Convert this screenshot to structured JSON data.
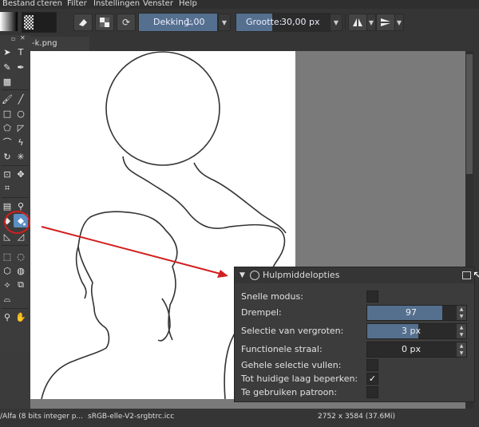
{
  "menubar": {
    "items": [
      "Bestand",
      "cteren",
      "Filter",
      "Instellingen",
      "Venster",
      "Help"
    ]
  },
  "toolbar": {
    "opacity_label": "Dekking:",
    "opacity_value": "1,00",
    "size_label": "Grootte:",
    "size_value": "30,00 px"
  },
  "document": {
    "tab_label": "-k.png"
  },
  "panel": {
    "title": "Hulpmiddelopties",
    "fast_mode_label": "Snelle modus:",
    "threshold_label": "Drempel:",
    "threshold_value": "97",
    "grow_selection_label": "Selectie van vergroten:",
    "grow_selection_value": "3 px",
    "feather_label": "Functionele straal:",
    "feather_value": "0 px",
    "fill_selection_label": "Gehele selectie vullen:",
    "limit_layer_label": "Tot huidige laag beperken:",
    "limit_layer_checked": "✓",
    "use_pattern_label": "Te gebruiken patroon:"
  },
  "status": {
    "colorspace": "/Alfa (8 bits integer p...",
    "profile": "sRGB-elle-V2-srgbtrc.icc",
    "dimensions": "2752 x 3584 (37.6Mi)"
  },
  "colors": {
    "accent": "#55708f",
    "annotation_red": "#d21f1f",
    "selected_tool": "#5b8ec2"
  }
}
